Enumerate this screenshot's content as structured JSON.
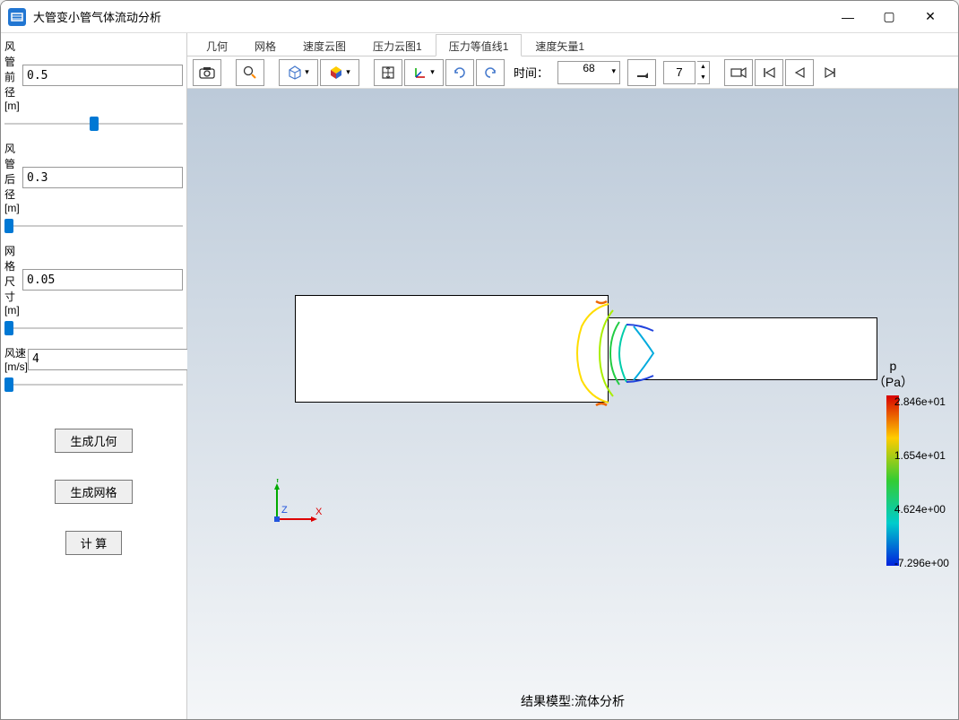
{
  "window": {
    "title": "大管变小管气体流动分析"
  },
  "sidebar": {
    "fields": [
      {
        "label": "风管前径[m]",
        "value": "0.5"
      },
      {
        "label": "风管后径[m]",
        "value": "0.3"
      },
      {
        "label": "网格尺寸[m]",
        "value": "0.05"
      },
      {
        "label": "风速[m/s]",
        "value": "4"
      }
    ],
    "buttons": {
      "gen_geom": "生成几何",
      "gen_mesh": "生成网格",
      "compute": "计 算"
    }
  },
  "tabs": [
    "几何",
    "网格",
    "速度云图",
    "压力云图1",
    "压力等值线1",
    "速度矢量1"
  ],
  "active_tab": 4,
  "toolbar": {
    "time_label": "时间：",
    "time_value": "68",
    "frame_skip": "7"
  },
  "viewer": {
    "caption": "结果模型:流体分析"
  },
  "legend": {
    "title": "p",
    "unit": "（Pa）",
    "values": [
      "2.846e+01",
      "1.654e+01",
      "4.624e+00",
      "-7.296e+00"
    ]
  },
  "chart_data": {
    "type": "contour",
    "title": "结果模型:流体分析",
    "variable": "p",
    "unit": "Pa",
    "range": [
      -7.296,
      28.46
    ],
    "colorbar_ticks": [
      28.46,
      16.54,
      4.624,
      -7.296
    ],
    "geometry": {
      "inlet_diameter_m": 0.5,
      "outlet_diameter_m": 0.3
    },
    "time_step": 68
  }
}
